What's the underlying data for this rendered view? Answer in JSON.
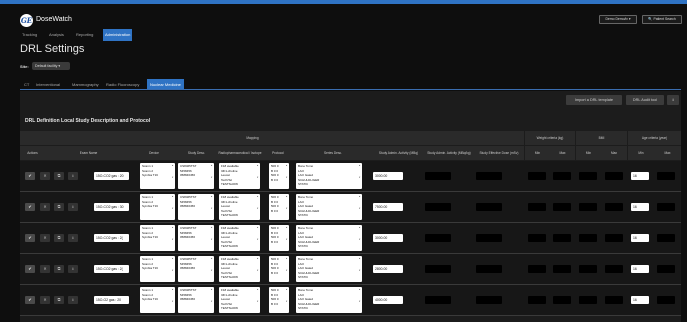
{
  "app": {
    "brand": "DoseWatch",
    "logo_text": "GE",
    "header_buttons": [
      "Demo Demo/iv ▾",
      "🔍 Patient Search"
    ]
  },
  "nav": [
    "Tracking",
    "Analysis",
    "Reporting",
    "Administration"
  ],
  "nav_active": 3,
  "page": {
    "title": "DRL Settings",
    "site_label": "Site:",
    "site_value": "Default facility ▾"
  },
  "tabs": [
    "CT",
    "Interventional",
    "Mammography",
    "Radio Fluoroscopy",
    "Nuclear Medicine"
  ],
  "tab_active": 4,
  "toolbar": {
    "import": "Import a DRL template",
    "audit": "DRL Audit tool",
    "download": "⭳"
  },
  "table": {
    "title": "DRL Definition Local Study Description and Protocol",
    "group_mapping": "Mapping",
    "group_weight": "Weight criteria (kg)",
    "group_bmi": "BMI",
    "group_age": "Age criteria (year)",
    "headers": {
      "actions": "Actions",
      "exam_name": "Exam Name",
      "device": "Device",
      "study_desc": "Study Desc.",
      "radiopharm": "Radiopharmaceutical / Isotope",
      "protocol": "Protocol",
      "series_desc": "Series Desc.",
      "study_admin_activity": "Study Admin. Activity (MBq)",
      "study_admin_activity_kg": "Study Admin. Activity (MBq/kg)",
      "study_effective_dose": "Study Effective Dose (mSv)",
      "min": "Min",
      "max": "Max"
    },
    "row_icons": [
      "✔",
      "✕",
      "⧉",
      "⭳"
    ],
    "device_options": [
      "Scann 1",
      "Scann 2",
      "Symbia T16"
    ],
    "studydesc_options": [
      "CS8465TST",
      "5458456",
      "058846456"
    ],
    "radio_options": [
      "F18 available",
      "I3F1-choline",
      "Leucet",
      "Tech/Tel",
      "TESTSHOW"
    ],
    "protocol_options": [
      "506 0",
      "B 0 0",
      "506 0",
      "B 0 0"
    ],
    "series_options": [
      "Bone Tomo",
      "LAO",
      "LAO Gated",
      "SCHULDLIGER",
      "STATIC"
    ],
    "rows": [
      {
        "exam": "15O-CO2 gas : 20",
        "activity": "3000.00",
        "age_min": "16"
      },
      {
        "exam": "15O-CO2 gas : 30",
        "activity": "7500.00",
        "age_min": "16"
      },
      {
        "exam": "15O-CO2 gas : 2(",
        "activity": "3000.00",
        "age_min": "16"
      },
      {
        "exam": "15O-CO2 gas : 2(",
        "activity": "2800.00",
        "age_min": "16"
      },
      {
        "exam": "15O-O2 gas : 20",
        "activity": "4000.00",
        "age_min": "16"
      }
    ]
  }
}
